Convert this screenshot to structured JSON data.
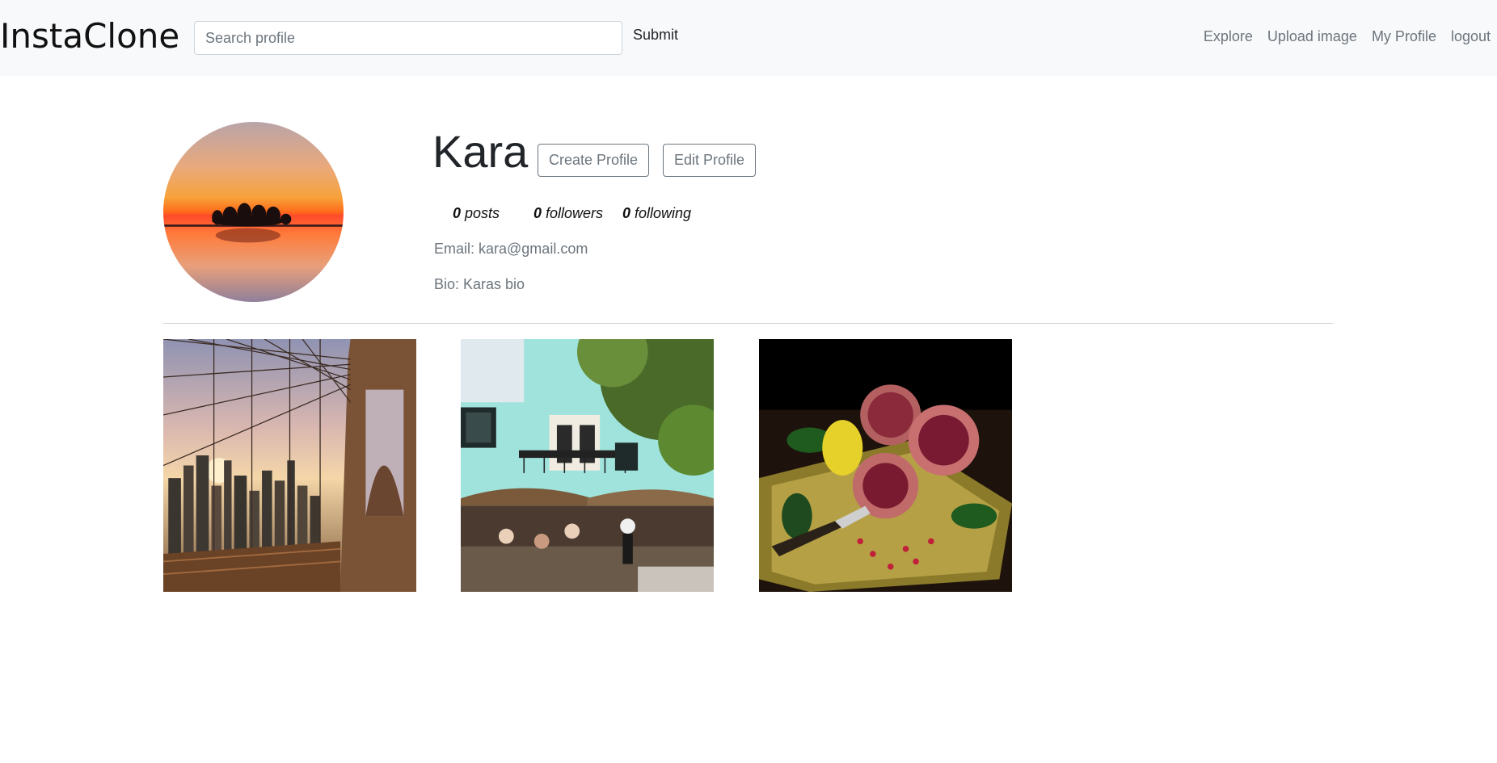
{
  "navbar": {
    "brand": "InstaClone",
    "search_placeholder": "Search profile",
    "submit_label": "Submit",
    "links": [
      "Explore",
      "Upload image",
      "My Profile",
      "logout"
    ]
  },
  "profile": {
    "username": "Kara",
    "create_label": "Create Profile",
    "edit_label": "Edit Profile",
    "stats": {
      "posts_count": "0",
      "posts_label": "posts",
      "followers_count": "0",
      "followers_label": "followers",
      "following_count": "0",
      "following_label": "following"
    },
    "email": "Email: kara@gmail.com",
    "bio": "Bio: Karas bio"
  }
}
